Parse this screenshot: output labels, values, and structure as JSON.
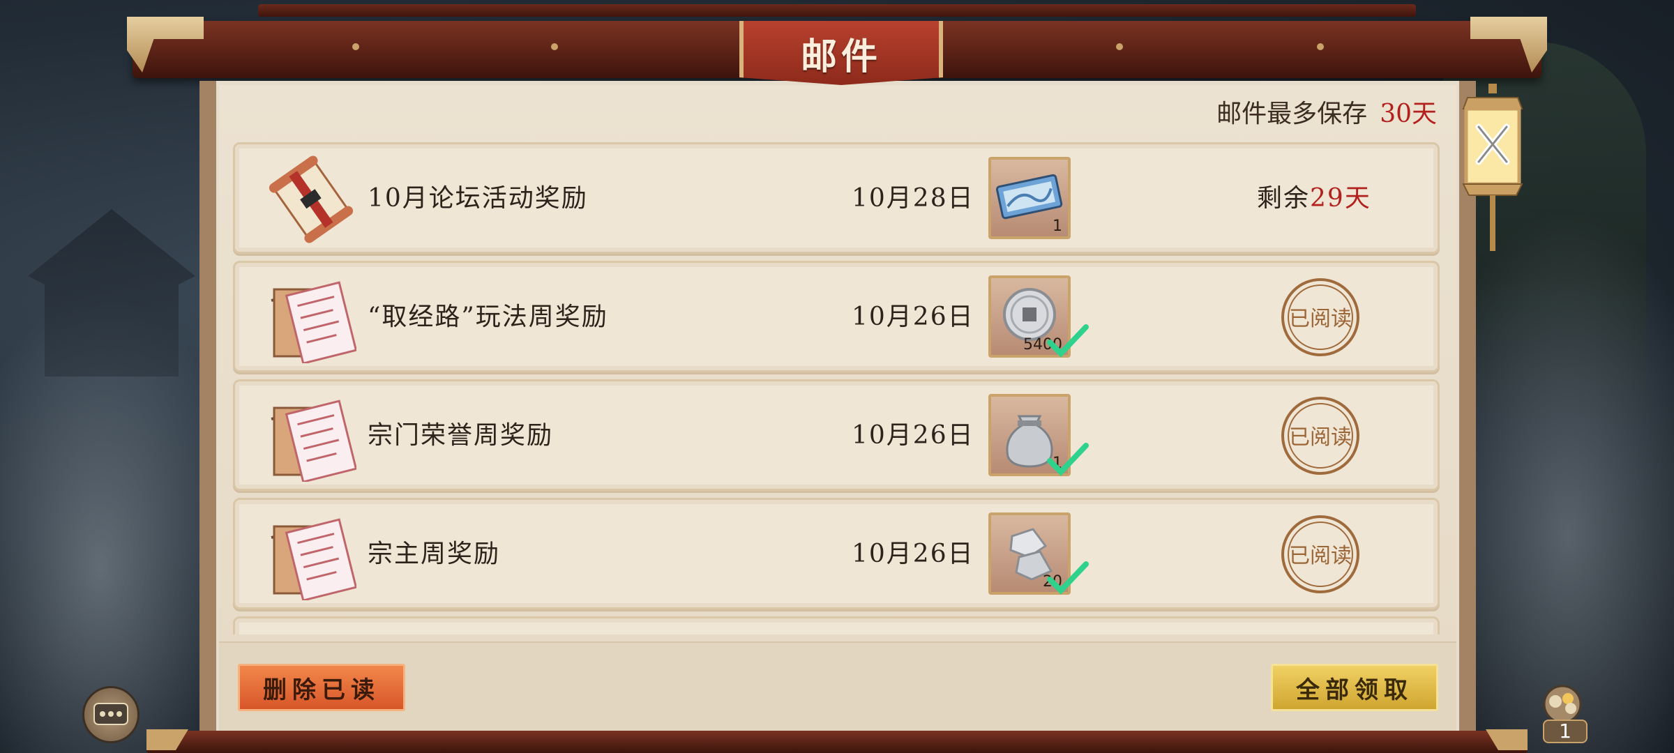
{
  "window": {
    "title": "邮件"
  },
  "retention": {
    "label": "邮件最多保存",
    "days": "30天"
  },
  "mails": [
    {
      "subject": "10月论坛活动奖励",
      "date": "10月28日",
      "item": "ticket-icon",
      "count": "1",
      "claimed": false,
      "status": "remaining",
      "remaining_label": "剩余",
      "remaining_days": "29天"
    },
    {
      "subject": "“取经路”玩法周奖励",
      "date": "10月26日",
      "item": "silver-coin-icon",
      "count": "5400",
      "claimed": true,
      "status": "read",
      "stamp": "已阅读"
    },
    {
      "subject": "宗门荣誉周奖励",
      "date": "10月26日",
      "item": "silver-bag-icon",
      "count": "1",
      "claimed": true,
      "status": "read",
      "stamp": "已阅读"
    },
    {
      "subject": "宗主周奖励",
      "date": "10月26日",
      "item": "silver-ingot-icon",
      "count": "20",
      "claimed": true,
      "status": "read",
      "stamp": "已阅读"
    }
  ],
  "buttons": {
    "delete_read": "删除已读",
    "claim_all": "全部领取"
  },
  "hud": {
    "bag_count": "1"
  },
  "colors": {
    "accent_red": "#b3211c",
    "check_green": "#2fd28c",
    "title_red": "#a33422"
  }
}
